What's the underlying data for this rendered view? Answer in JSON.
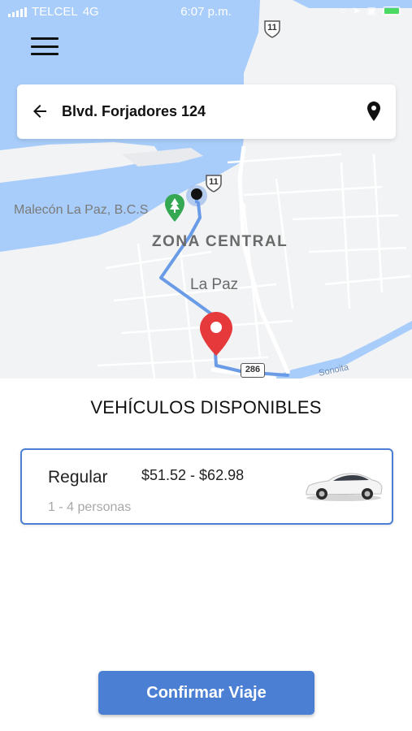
{
  "status_bar": {
    "carrier": "TELCEL",
    "network": "4G",
    "time": "6:07 p.m."
  },
  "map": {
    "labels": {
      "malecon": "Malecón La Paz, B.C.S",
      "zona_central": "ZONA CENTRAL",
      "la_paz": "La Paz",
      "sonoita": "Sonoita"
    },
    "highway_11": "11",
    "highway_286": "286",
    "colors": {
      "water": "#a9cdfa",
      "land": "#f1f3f4",
      "route": "#6a9be6",
      "pin": "#e5393c",
      "park": "#34a853"
    }
  },
  "search": {
    "address": "Blvd. Forjadores 124",
    "back_icon": "arrow-left-icon",
    "location_icon": "map-pin-icon"
  },
  "vehicles": {
    "title": "VEHÍCULOS DISPONIBLES",
    "items": [
      {
        "name": "Regular",
        "price": "$51.52 - $62.98",
        "capacity": "1 - 4 personas",
        "icon": "car-icon"
      }
    ]
  },
  "actions": {
    "confirm_label": "Confirmar Viaje",
    "accent": "#4a7fd4"
  }
}
